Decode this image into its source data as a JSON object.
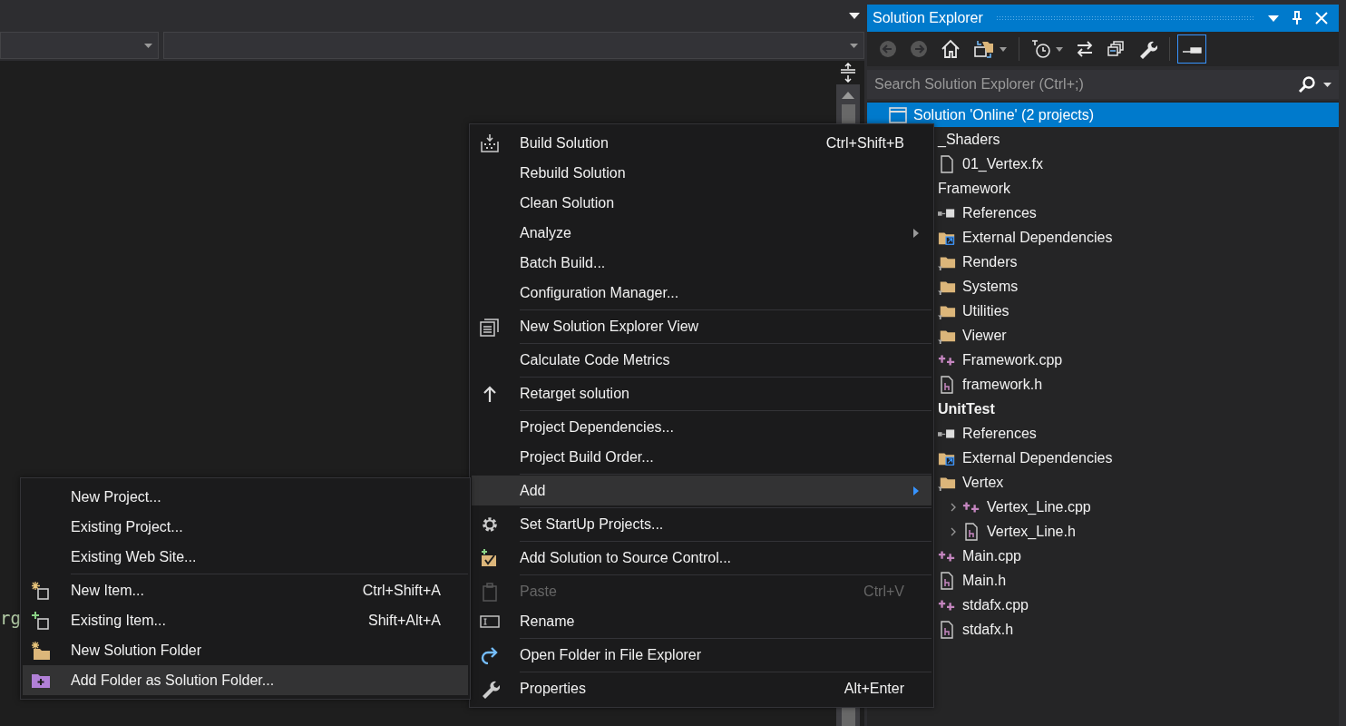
{
  "editor": {
    "code_fragment": "rg"
  },
  "explorer": {
    "title": "Solution Explorer",
    "toolbar": [
      {
        "disabled": true,
        "selected": false
      },
      {
        "disabled": true,
        "selected": false
      },
      {
        "disabled": false,
        "selected": false
      },
      {
        "disabled": false,
        "selected": false
      },
      {
        "disabled": false,
        "selected": false
      },
      {
        "disabled": false,
        "selected": false
      },
      {
        "disabled": false,
        "selected": false
      },
      {
        "disabled": false,
        "selected": false
      },
      {
        "disabled": false,
        "selected": true
      }
    ],
    "search": {
      "placeholder": "Search Solution Explorer (Ctrl+;)"
    },
    "tree": [
      {
        "label": "Solution 'Online' (2 projects)",
        "kind": "solution",
        "selected": true,
        "children": [
          {
            "label": "_Shaders",
            "selected": false,
            "children": [
              {
                "label": "01_Vertex.fx",
                "kind": "file",
                "selected": false
              }
            ]
          },
          {
            "label": "Framework",
            "startup": false,
            "selected": false,
            "children": [
              {
                "label": "References",
                "kind": "references",
                "selected": false
              },
              {
                "label": "External Dependencies",
                "kind": "external",
                "selected": false
              },
              {
                "label": "Renders",
                "kind": "filter",
                "selected": false
              },
              {
                "label": "Systems",
                "kind": "filter",
                "selected": false
              },
              {
                "label": "Utilities",
                "kind": "filter",
                "selected": false
              },
              {
                "label": "Viewer",
                "kind": "filter",
                "selected": false
              },
              {
                "label": "Framework.cpp",
                "kind": "cpp",
                "selected": false
              },
              {
                "label": "framework.h",
                "kind": "header",
                "selected": false
              }
            ]
          },
          {
            "label": "UnitTest",
            "startup": true,
            "selected": false,
            "children": [
              {
                "label": "References",
                "kind": "references",
                "selected": false
              },
              {
                "label": "External Dependencies",
                "kind": "external",
                "selected": false
              },
              {
                "label": "Vertex",
                "kind": "filter",
                "selected": false,
                "children": [
                  {
                    "label": "Vertex_Line.cpp",
                    "kind": "cpp",
                    "selected": false,
                    "expanded": false
                  },
                  {
                    "label": "Vertex_Line.h",
                    "kind": "header",
                    "selected": false,
                    "expanded": false
                  }
                ]
              },
              {
                "label": "Main.cpp",
                "kind": "cpp",
                "selected": false
              },
              {
                "label": "Main.h",
                "kind": "header",
                "selected": false
              },
              {
                "label": "stdafx.cpp",
                "kind": "cpp",
                "selected": false
              },
              {
                "label": "stdafx.h",
                "kind": "header",
                "selected": false
              }
            ]
          }
        ]
      }
    ]
  },
  "menu": {
    "items": [
      {
        "kind": "command",
        "label": "Build Solution",
        "shortcut": "Ctrl+Shift+B",
        "selected": false,
        "disabled": false,
        "submenu": false
      },
      {
        "kind": "command",
        "label": "Rebuild Solution",
        "selected": false,
        "disabled": false,
        "submenu": false
      },
      {
        "kind": "command",
        "label": "Clean Solution",
        "selected": false,
        "disabled": false,
        "submenu": false
      },
      {
        "kind": "command",
        "label": "Analyze",
        "selected": false,
        "disabled": false,
        "submenu": true
      },
      {
        "kind": "command",
        "label": "Batch Build...",
        "selected": false,
        "disabled": false,
        "submenu": false
      },
      {
        "kind": "command",
        "label": "Configuration Manager...",
        "selected": false,
        "disabled": false,
        "submenu": false
      },
      {
        "kind": "separator"
      },
      {
        "kind": "command",
        "label": "New Solution Explorer View",
        "selected": false,
        "disabled": false,
        "submenu": false
      },
      {
        "kind": "separator"
      },
      {
        "kind": "command",
        "label": "Calculate Code Metrics",
        "selected": false,
        "disabled": false,
        "submenu": false
      },
      {
        "kind": "separator"
      },
      {
        "kind": "command",
        "label": "Retarget solution",
        "selected": false,
        "disabled": false,
        "submenu": false
      },
      {
        "kind": "separator"
      },
      {
        "kind": "command",
        "label": "Project Dependencies...",
        "selected": false,
        "disabled": false,
        "submenu": false
      },
      {
        "kind": "command",
        "label": "Project Build Order...",
        "selected": false,
        "disabled": false,
        "submenu": false
      },
      {
        "kind": "separator"
      },
      {
        "kind": "command",
        "label": "Add",
        "selected": true,
        "disabled": false,
        "submenu": true
      },
      {
        "kind": "separator"
      },
      {
        "kind": "command",
        "label": "Set StartUp Projects...",
        "selected": false,
        "disabled": false,
        "submenu": false
      },
      {
        "kind": "separator"
      },
      {
        "kind": "command",
        "label": "Add Solution to Source Control...",
        "selected": false,
        "disabled": false,
        "submenu": false
      },
      {
        "kind": "separator"
      },
      {
        "kind": "command",
        "label": "Paste",
        "shortcut": "Ctrl+V",
        "selected": false,
        "disabled": true,
        "submenu": false
      },
      {
        "kind": "command",
        "label": "Rename",
        "selected": false,
        "disabled": false,
        "submenu": false
      },
      {
        "kind": "separator"
      },
      {
        "kind": "command",
        "label": "Open Folder in File Explorer",
        "selected": false,
        "disabled": false,
        "submenu": false
      },
      {
        "kind": "separator"
      },
      {
        "kind": "command",
        "label": "Properties",
        "shortcut": "Alt+Enter",
        "selected": false,
        "disabled": false,
        "submenu": false
      }
    ]
  },
  "add_submenu": {
    "items": [
      {
        "kind": "command",
        "label": "New Project...",
        "selected": false
      },
      {
        "kind": "command",
        "label": "Existing Project...",
        "selected": false
      },
      {
        "kind": "command",
        "label": "Existing Web Site...",
        "selected": false
      },
      {
        "kind": "separator"
      },
      {
        "kind": "command",
        "label": "New Item...",
        "shortcut": "Ctrl+Shift+A",
        "selected": false
      },
      {
        "kind": "command",
        "label": "Existing Item...",
        "shortcut": "Shift+Alt+A",
        "selected": false
      },
      {
        "kind": "command",
        "label": "New Solution Folder",
        "selected": false
      },
      {
        "kind": "command",
        "label": "Add Folder as Solution Folder...",
        "selected": true
      }
    ]
  }
}
